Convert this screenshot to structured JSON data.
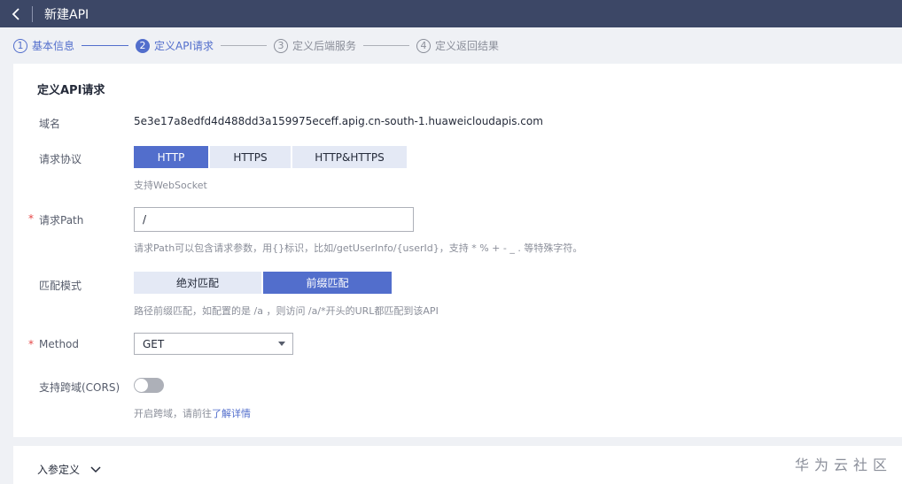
{
  "header": {
    "title": "新建API"
  },
  "steps": [
    {
      "num": "1",
      "label": "基本信息"
    },
    {
      "num": "2",
      "label": "定义API请求"
    },
    {
      "num": "3",
      "label": "定义后端服务"
    },
    {
      "num": "4",
      "label": "定义返回结果"
    }
  ],
  "form": {
    "section_title": "定义API请求",
    "domain": {
      "label": "域名",
      "value": "5e3e17a8edfd4d488dd3a159975eceff.apig.cn-south-1.huaweicloudapis.com"
    },
    "protocol": {
      "label": "请求协议",
      "options": [
        "HTTP",
        "HTTPS",
        "HTTP&HTTPS"
      ],
      "selected": "HTTP",
      "hint": "支持WebSocket"
    },
    "path": {
      "required_mark": "*",
      "label": "请求Path",
      "value": "/",
      "hint": "请求Path可以包含请求参数，用{}标识，比如/getUserInfo/{userId}，支持 * % + - _ . 等特殊字符。"
    },
    "match": {
      "label": "匹配模式",
      "options": [
        "绝对匹配",
        "前缀匹配"
      ],
      "selected": "前缀匹配",
      "hint": "路径前缀匹配，如配置的是 /a ，则访问 /a/*开头的URL都匹配到该API"
    },
    "method": {
      "required_mark": "*",
      "label": "Method",
      "value": "GET"
    },
    "cors": {
      "label": "支持跨域(CORS)",
      "enabled": false,
      "hint_prefix": "开启跨域，请前往",
      "hint_link": "了解详情"
    }
  },
  "params": {
    "label": "入参定义"
  },
  "watermark": "华为云社区",
  "colors": {
    "topbar": "#3c4766",
    "accent": "#526ecc",
    "required": "#e54545"
  }
}
